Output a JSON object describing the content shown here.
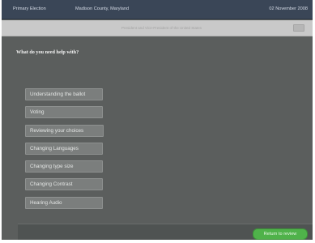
{
  "header": {
    "election": "Primary Election",
    "county": "Madison County, Maryland",
    "date": "02 November 2008"
  },
  "contest": {
    "text": "President and Vice-President of the United States"
  },
  "help": {
    "title": "What do you need help with?",
    "options": [
      "Understanding the ballot",
      "Voting",
      "Reviewing your choices",
      "Changing Languages",
      "Changing type size",
      "Changing Contrast",
      "Hearing Audio"
    ]
  },
  "footer": {
    "return_label": "Return to review"
  },
  "colors": {
    "background": "#5b5e5d",
    "header": "#3a4657",
    "option": "#7b7e7d",
    "accent_green": "#4fb24a"
  }
}
